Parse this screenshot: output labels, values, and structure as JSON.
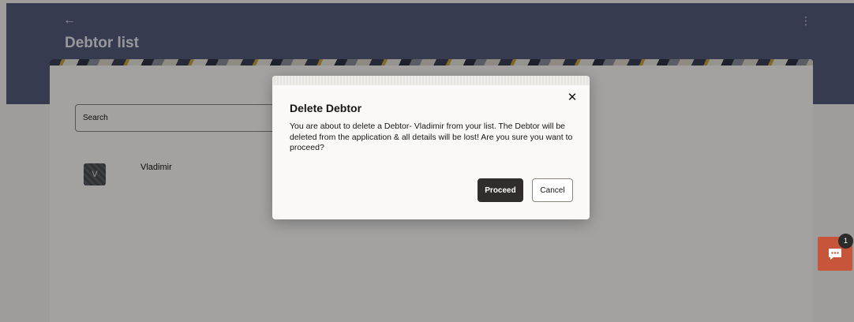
{
  "header": {
    "title": "Debtor list",
    "back_icon": "arrow-left-icon",
    "menu_icon": "kebab-vertical-icon"
  },
  "search": {
    "placeholder": "Search"
  },
  "debtors": [
    {
      "initial": "V",
      "name": "Vladimir"
    }
  ],
  "dialog": {
    "title": "Delete Debtor",
    "message": "You are about to delete a Debtor- Vladimir from your list. The Debtor will be deleted from the application & all details will be lost! Are you sure you want to proceed?",
    "close_icon": "close-icon",
    "proceed_label": "Proceed",
    "cancel_label": "Cancel"
  },
  "chat": {
    "badge_count": "1",
    "icon": "chat-bubble-icon"
  },
  "colors": {
    "header_bg": "#555b7a",
    "primary_button": "#312d2a",
    "chat_button": "#c7553a"
  }
}
